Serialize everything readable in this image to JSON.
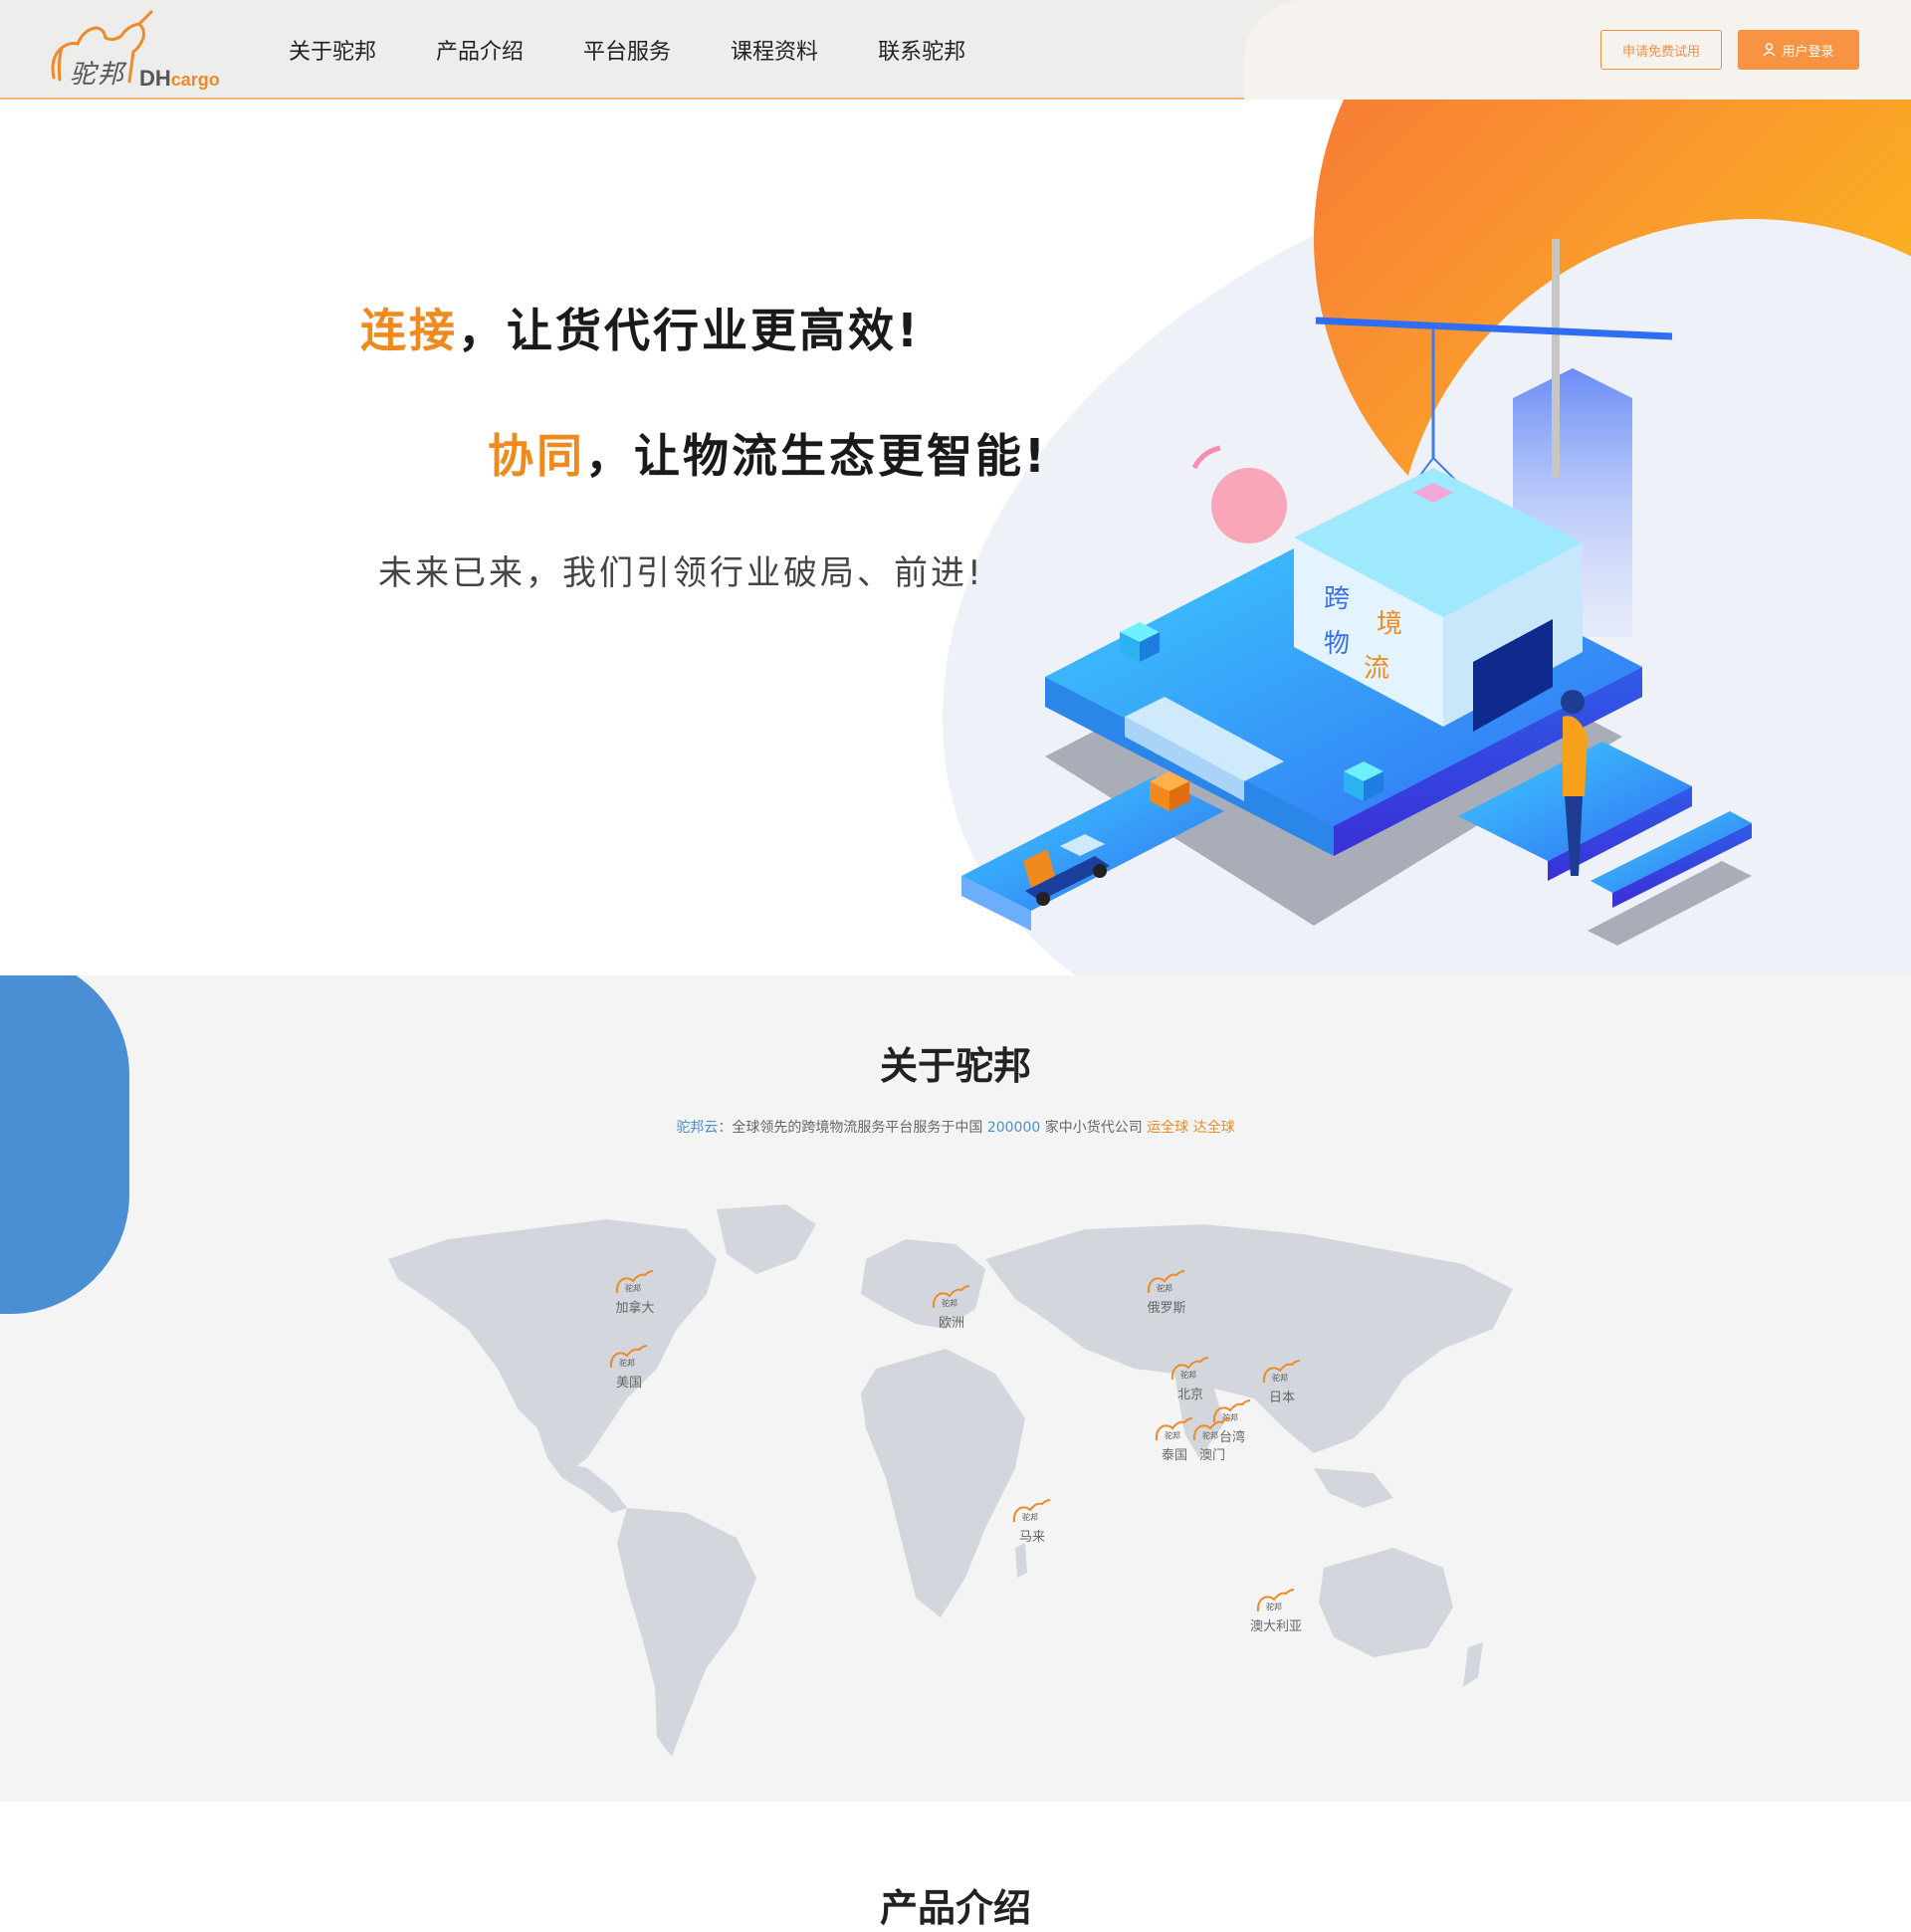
{
  "header": {
    "logo_cn": "驼邦",
    "logo_en_dh": "DH",
    "logo_en_cargo": "cargo",
    "nav": [
      "关于驼邦",
      "产品介绍",
      "平台服务",
      "课程资料",
      "联系驼邦"
    ],
    "trial_button": "申请免费试用",
    "login_button": "用户登录"
  },
  "hero": {
    "title1_highlight": "连接",
    "title1_rest": "，让货代行业更高效!",
    "title2_highlight": "协同",
    "title2_rest": "，让物流生态更智能!",
    "subtitle": "未来已来，我们引领行业破局、前进!",
    "building_sign": [
      "跨",
      "境",
      "物",
      "流"
    ]
  },
  "about": {
    "title": "关于驼邦",
    "desc_brand": "驼邦云",
    "desc_sep": "：",
    "desc_text1": "全球领先的跨境物流服务平台服务于中国",
    "desc_number": "200000",
    "desc_text2": "家中小货代公司",
    "desc_tag1": "运全球",
    "desc_tag2": "达全球",
    "marker_logo": "驼邦",
    "markers": [
      "加拿大",
      "美国",
      "欧洲",
      "俄罗斯",
      "北京",
      "日本",
      "台湾",
      "泰国",
      "澳门",
      "马来",
      "澳大利亚"
    ]
  },
  "products": {
    "title": "产品介绍"
  },
  "colors": {
    "accent_orange": "#f08a1e",
    "login_orange": "#f89343",
    "brand_blue": "#4a8fd3",
    "map_land": "#d3d6dc"
  }
}
